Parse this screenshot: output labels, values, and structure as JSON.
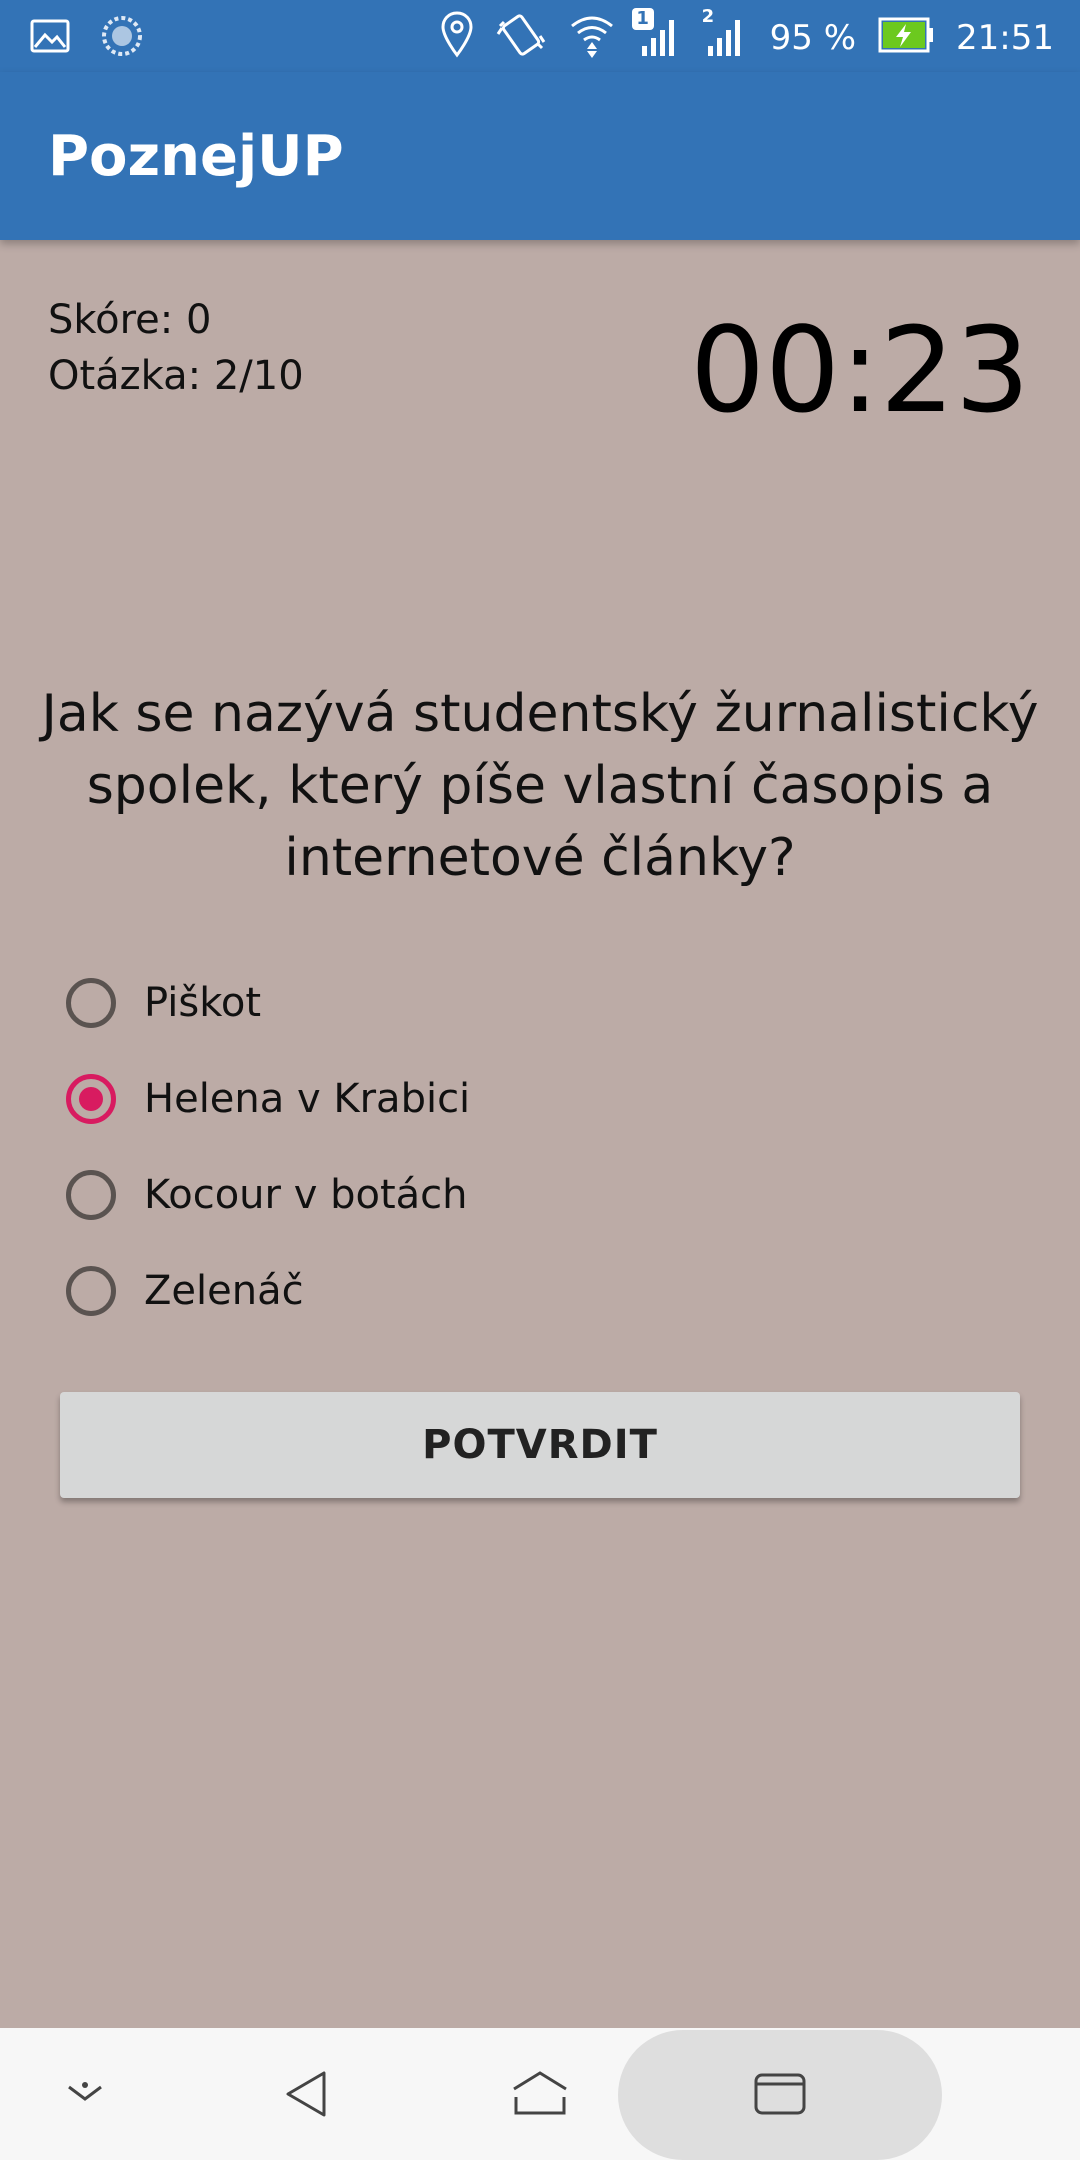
{
  "status_bar": {
    "left_icons": [
      "gallery-icon",
      "sync-icon"
    ],
    "right_icons": [
      "location-icon",
      "vibrate-icon",
      "wifi-icon",
      "signal-sim1-icon",
      "signal-sim2-icon",
      "battery-charging-icon"
    ],
    "sim1_badge": "1",
    "sim2_badge": "2",
    "battery": "95 %",
    "time": "21:51",
    "colors": {
      "background": "#3373b6",
      "battery_fill": "#6cc91f"
    }
  },
  "app_bar": {
    "title": "PoznejUP",
    "color": "#3373b6"
  },
  "quiz": {
    "score": "Skóre: 0",
    "question_counter": "Otázka: 2/10",
    "timer": "00:23",
    "question": "Jak se nazývá studentský žurnalistický spolek, který píše vlastní časopis a internetové články?",
    "options": [
      {
        "label": "Piškot",
        "selected": false
      },
      {
        "label": "Helena v Krabici",
        "selected": true
      },
      {
        "label": "Kocour v botách",
        "selected": false
      },
      {
        "label": "Zelenáč",
        "selected": false
      }
    ],
    "confirm_label": "POTVRDIT",
    "colors": {
      "background": "#bcaba6",
      "radio_selected": "#d81b60",
      "button": "#d6d7d7"
    }
  },
  "nav_bar": {
    "items": [
      "notification-pull-icon",
      "back-icon",
      "home-icon",
      "recents-icon"
    ]
  }
}
